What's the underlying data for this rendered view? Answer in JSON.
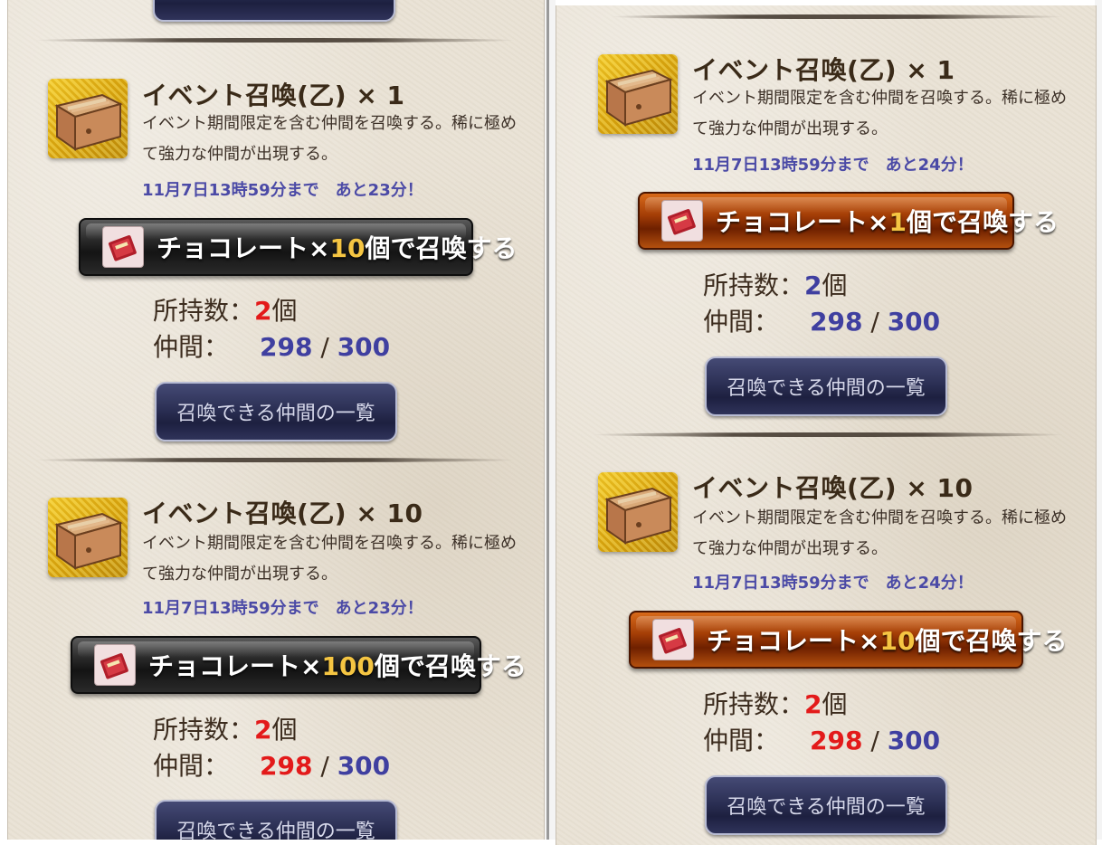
{
  "left_panel": {
    "items": [
      {
        "title": "イベント召喚(乙) × 1",
        "description": "イベント期間限定を含む仲間を召喚する。稀に極めて強力な仲間が出現する。",
        "deadline": "11月7日13時59分まで",
        "remaining": "あと23分！",
        "summon_button": {
          "prefix": "チョコレート×",
          "quantity": "10",
          "suffix": "個で召喚する",
          "style": "dark"
        },
        "owned_label": "所持数：",
        "owned_value": "2",
        "owned_unit": "個",
        "owned_color": "#e31a1a",
        "members_label": "仲間：",
        "members_current": "298",
        "members_current_color": "#3f3fa0",
        "members_sep": "/",
        "members_max": "300",
        "list_button": "召喚できる仲間の一覧"
      },
      {
        "title": "イベント召喚(乙) × 10",
        "description": "イベント期間限定を含む仲間を召喚する。稀に極めて強力な仲間が出現する。",
        "deadline": "11月7日13時59分まで",
        "remaining": "あと23分！",
        "summon_button": {
          "prefix": "チョコレート×",
          "quantity": "100",
          "suffix": "個で召喚する",
          "style": "dark"
        },
        "owned_label": "所持数：",
        "owned_value": "2",
        "owned_unit": "個",
        "owned_color": "#e31a1a",
        "members_label": "仲間：",
        "members_current": "298",
        "members_current_color": "#e31a1a",
        "members_sep": "/",
        "members_max": "300",
        "list_button": "召喚できる仲間の一覧"
      }
    ]
  },
  "right_panel": {
    "items": [
      {
        "title": "イベント召喚(乙) × 1",
        "description": "イベント期間限定を含む仲間を召喚する。稀に極めて強力な仲間が出現する。",
        "deadline": "11月7日13時59分まで",
        "remaining": "あと24分！",
        "summon_button": {
          "prefix": "チョコレート×",
          "quantity": "1",
          "suffix": "個で召喚する",
          "style": "orange"
        },
        "owned_label": "所持数：",
        "owned_value": "2",
        "owned_unit": "個",
        "owned_color": "#3f3fa0",
        "members_label": "仲間：",
        "members_current": "298",
        "members_current_color": "#3f3fa0",
        "members_sep": "/",
        "members_max": "300",
        "list_button": "召喚できる仲間の一覧"
      },
      {
        "title": "イベント召喚(乙) × 10",
        "description": "イベント期間限定を含む仲間を召喚する。稀に極めて強力な仲間が出現する。",
        "deadline": "11月7日13時59分まで",
        "remaining": "あと24分！",
        "summon_button": {
          "prefix": "チョコレート×",
          "quantity": "10",
          "suffix": "個で召喚する",
          "style": "orange"
        },
        "owned_label": "所持数：",
        "owned_value": "2",
        "owned_unit": "個",
        "owned_color": "#e31a1a",
        "members_label": "仲間：",
        "members_current": "298",
        "members_current_color": "#e31a1a",
        "members_sep": "/",
        "members_max": "300",
        "list_button": "召喚できる仲間の一覧"
      }
    ]
  },
  "icons": {
    "chest": "wooden-summon-chest-icon",
    "chocolate": "chocolate-box-icon"
  },
  "colors": {
    "deadline": "#4b4aa6",
    "count_blue": "#3f3fa0",
    "count_red": "#e31a1a",
    "quantity_gold": "#f5c542"
  }
}
